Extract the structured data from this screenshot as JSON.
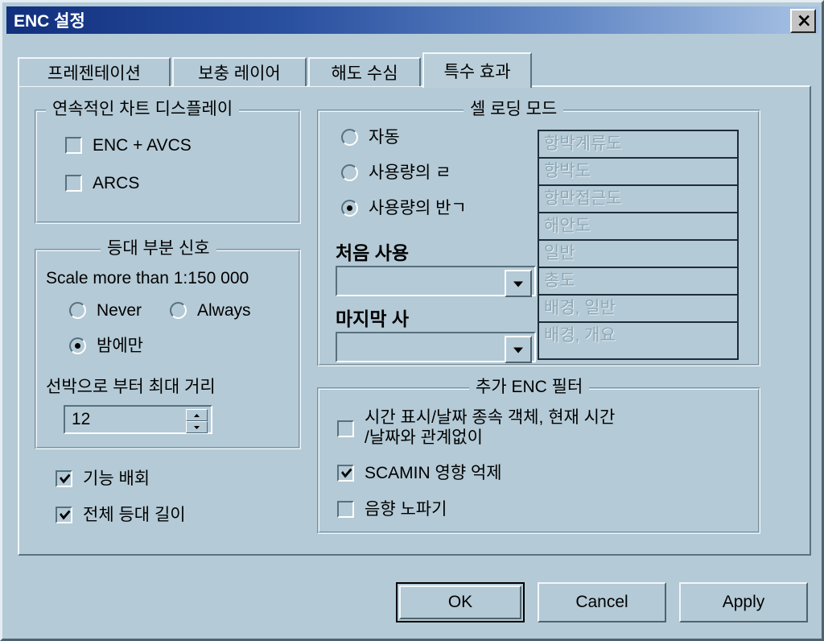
{
  "window": {
    "title": "ENC 설정",
    "close_icon": "close-icon"
  },
  "tabs": [
    {
      "label": "프레젠테이션",
      "active": false
    },
    {
      "label": "보충 레이어",
      "active": false
    },
    {
      "label": "해도 수심",
      "active": false
    },
    {
      "label": "특수 효과",
      "active": true
    }
  ],
  "continuous_chart_display": {
    "title": "연속적인 차트 디스플레이",
    "checkboxes": [
      {
        "label": "ENC + AVCS",
        "checked": false
      },
      {
        "label": "ARCS",
        "checked": false
      }
    ]
  },
  "light_sector": {
    "title": "등대 부분 신호",
    "scale_label": "Scale more than 1:150 000",
    "radios": [
      {
        "label": "Never",
        "checked": false
      },
      {
        "label": "Always",
        "checked": false
      },
      {
        "label": "밤에만",
        "checked": true
      }
    ],
    "distance_label": "선박으로 부터 최대 거리",
    "distance_value": "12"
  },
  "standalone_checkboxes": [
    {
      "label": "기능 배회",
      "checked": true
    },
    {
      "label": "전체 등대 길이",
      "checked": true
    }
  ],
  "cell_loading_mode": {
    "title": "셀 로딩 모드",
    "radios": [
      {
        "label": "자동",
        "checked": false
      },
      {
        "label": "사용량의 ㄹ",
        "checked": false
      },
      {
        "label": "사용량의 반ㄱ",
        "checked": true
      }
    ],
    "first_use_label": "처음 사용",
    "first_use_value": "",
    "last_use_label": "마지막 사",
    "last_use_value": "",
    "usage_list": [
      "항박계류도",
      "항박도",
      "항만접근도",
      "해안도",
      "일반",
      "총도",
      "배경, 일반",
      "배경, 개요"
    ]
  },
  "enc_filter": {
    "title": "추가 ENC 필터",
    "checkboxes": [
      {
        "label": "시간 표시/날짜 종속 객체, 현재 시간\n/날짜와 관계없이",
        "checked": false
      },
      {
        "label": "SCAMIN 영향 억제",
        "checked": true
      },
      {
        "label": "음향 노파기",
        "checked": false
      }
    ]
  },
  "buttons": {
    "ok": "OK",
    "cancel": "Cancel",
    "apply": "Apply"
  },
  "colors": {
    "dialog_bg": "#b4cad6",
    "titlebar_start": "#11307e",
    "titlebar_end": "#a8c2e4",
    "title_text": "#ffffff",
    "disabled_text": "#8fa7b5"
  }
}
